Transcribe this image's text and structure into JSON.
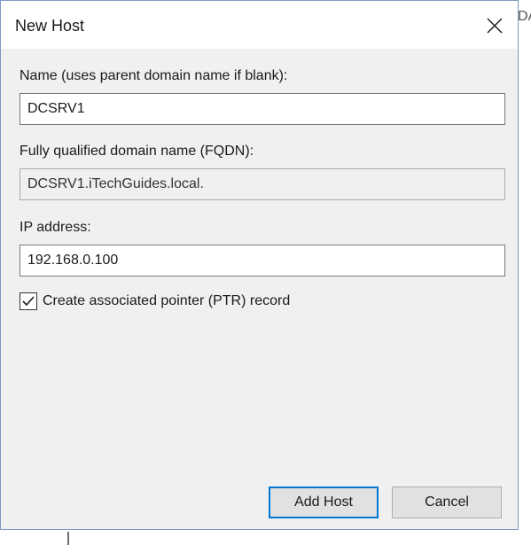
{
  "window": {
    "title": "New Host",
    "background_partial_text": "DA"
  },
  "fields": {
    "name_label": "Name (uses parent domain name if blank):",
    "name_value": "DCSRV1",
    "fqdn_label": "Fully qualified domain name (FQDN):",
    "fqdn_value": "DCSRV1.iTechGuides.local.",
    "ip_label": "IP address:",
    "ip_value": "192.168.0.100"
  },
  "checkbox": {
    "label": "Create associated pointer (PTR) record",
    "checked": true
  },
  "buttons": {
    "add_host": "Add Host",
    "cancel": "Cancel"
  },
  "colors": {
    "accent": "#0078d7",
    "dialog_bg": "#f0f0f0",
    "titlebar_bg": "#ffffff"
  },
  "icons": {
    "close": "close-icon",
    "check": "checkmark-icon"
  }
}
